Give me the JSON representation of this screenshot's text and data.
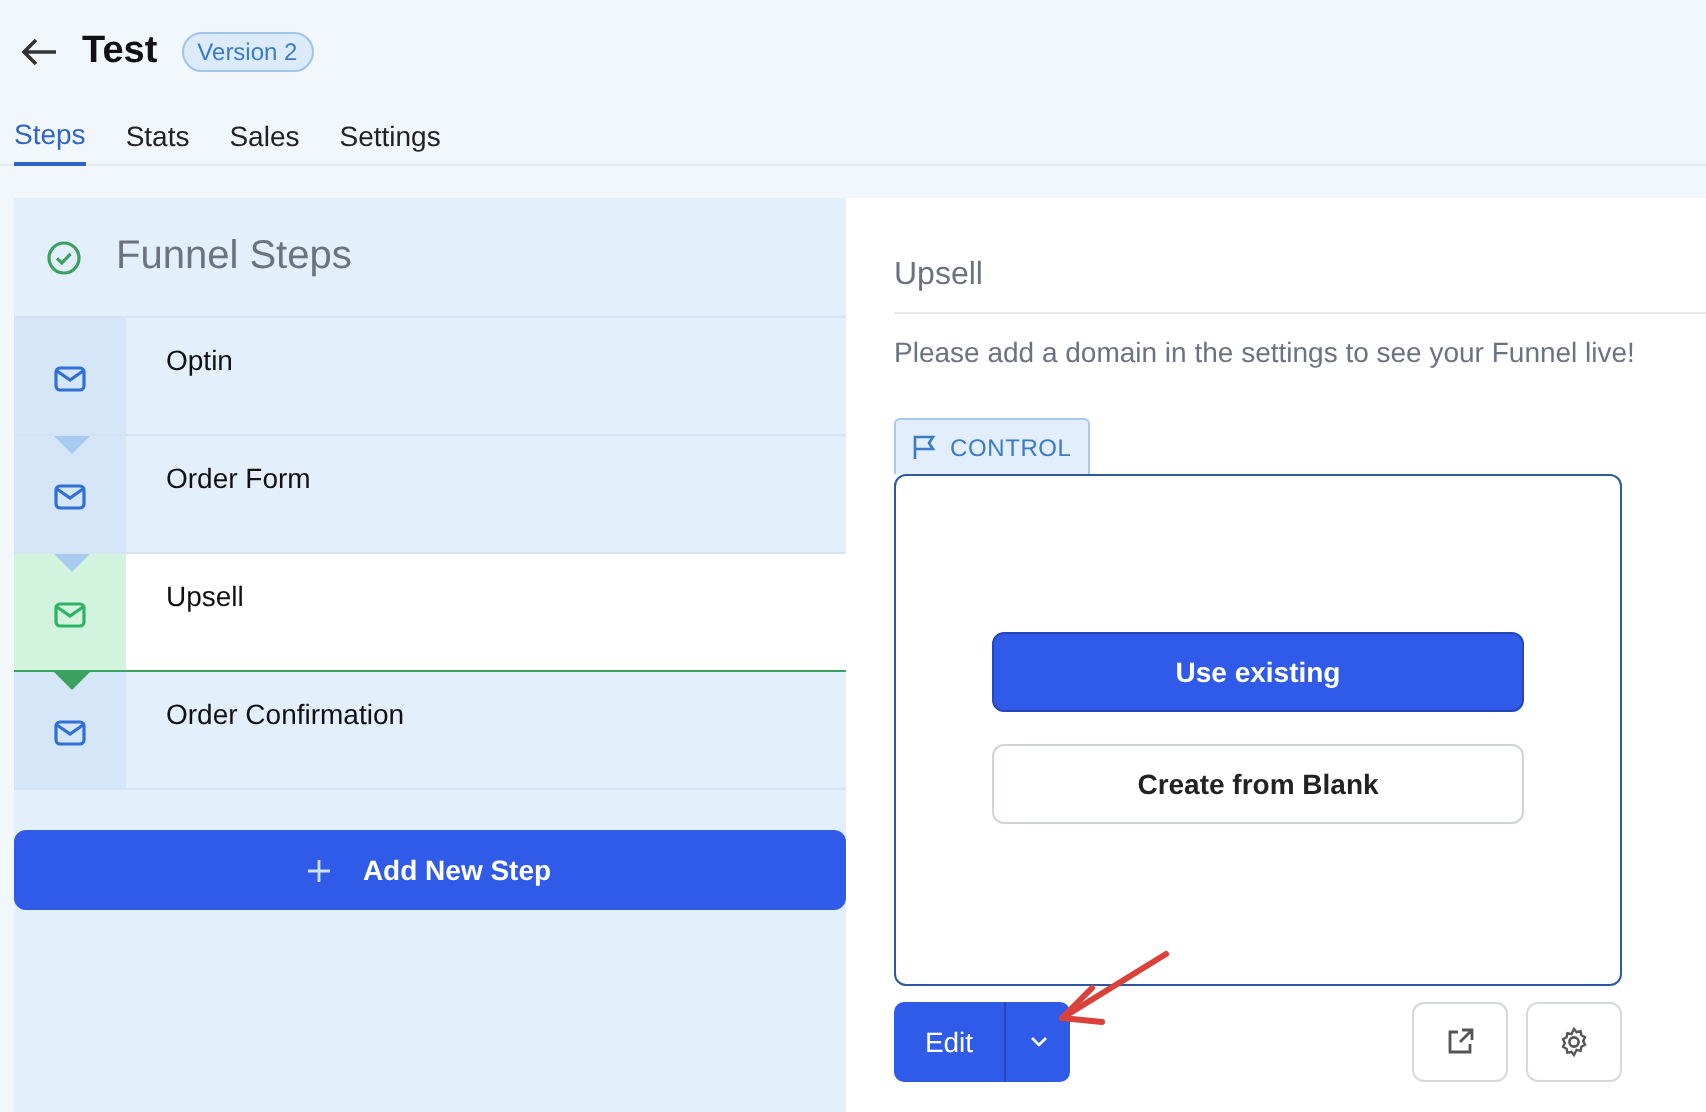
{
  "header": {
    "title": "Test",
    "badge": "Version 2"
  },
  "tabs": [
    {
      "label": "Steps",
      "selected": true
    },
    {
      "label": "Stats",
      "selected": false
    },
    {
      "label": "Sales",
      "selected": false
    },
    {
      "label": "Settings",
      "selected": false
    }
  ],
  "funnel": {
    "title": "Funnel Steps",
    "steps": [
      {
        "name": "Optin",
        "selected": false
      },
      {
        "name": "Order Form",
        "selected": false
      },
      {
        "name": "Upsell",
        "selected": true
      },
      {
        "name": "Order Confirmation",
        "selected": false
      }
    ],
    "add_button": "Add New Step"
  },
  "detail": {
    "title": "Upsell",
    "notice": "Please add a domain in the settings to see your Funnel live!",
    "tag": "CONTROL",
    "buttons": [
      {
        "label": "Use existing",
        "kind": "primary"
      },
      {
        "label": "Create from Blank",
        "kind": "secondary"
      }
    ],
    "edit_button": "Edit"
  }
}
